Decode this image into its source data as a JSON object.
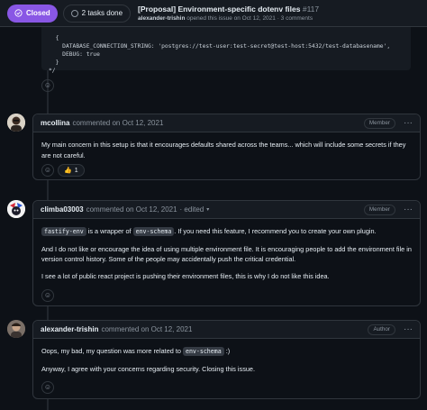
{
  "header": {
    "state_label": "Closed",
    "tasks_label": "2 tasks done",
    "issue_title": "[Proposal] Environment-specific dotenv files",
    "issue_number": "#117",
    "opener": "alexander-trishin",
    "opened_text": "opened this issue on Oct 12, 2021 · 3 comments"
  },
  "codebox": {
    "lines": [
      "  {",
      "    DATABASE_CONNECTION_STRING: 'postgres://test-user:test-secret@test-host:5432/test-databasename',",
      "    DEBUG: true",
      "  }",
      "*/"
    ]
  },
  "comments": [
    {
      "author": "mcollina",
      "meta": "commented on Oct 12, 2021",
      "role": "Member",
      "edited": "",
      "paragraphs": [
        "My main concern in this setup is that it encourages defaults shared across the teams... which will include some secrets if they are not careful."
      ],
      "reaction": {
        "emoji": "👍",
        "count": "1"
      }
    },
    {
      "author": "climba03003",
      "meta": "commented on Oct 12, 2021",
      "edited": "· edited",
      "role": "Member",
      "p1_code1": "fastify-env",
      "p1_text1": " is a wrapper of ",
      "p1_code2": "env-schema",
      "p1_text2": ". If you need this feature, I recommend you to create your own plugin.",
      "p2": "And I do not like or encourage the idea of using multiple environment file. It is encouraging people to add the environment file in version control history. Some of the people may accidentally push the critical credential.",
      "p3": "I see a lot of public react project is pushing their environment files, this is why I do not like this idea."
    },
    {
      "author": "alexander-trishin",
      "meta": "commented on Oct 12, 2021",
      "role": "Author",
      "p1_text": "Oops, my bad, my question was more related to ",
      "p1_code": "env-schema",
      "p1_tail": " :)",
      "p2": "Anyway, I agree with your concerns regarding security. Closing this issue."
    }
  ],
  "icons": {
    "smiley": "☺",
    "kebab": "···",
    "caret": "▾"
  },
  "colors": {
    "background": "#0d1117",
    "closed_badge": "#8957e5",
    "border": "#30363d",
    "header_bg": "#161b22"
  }
}
